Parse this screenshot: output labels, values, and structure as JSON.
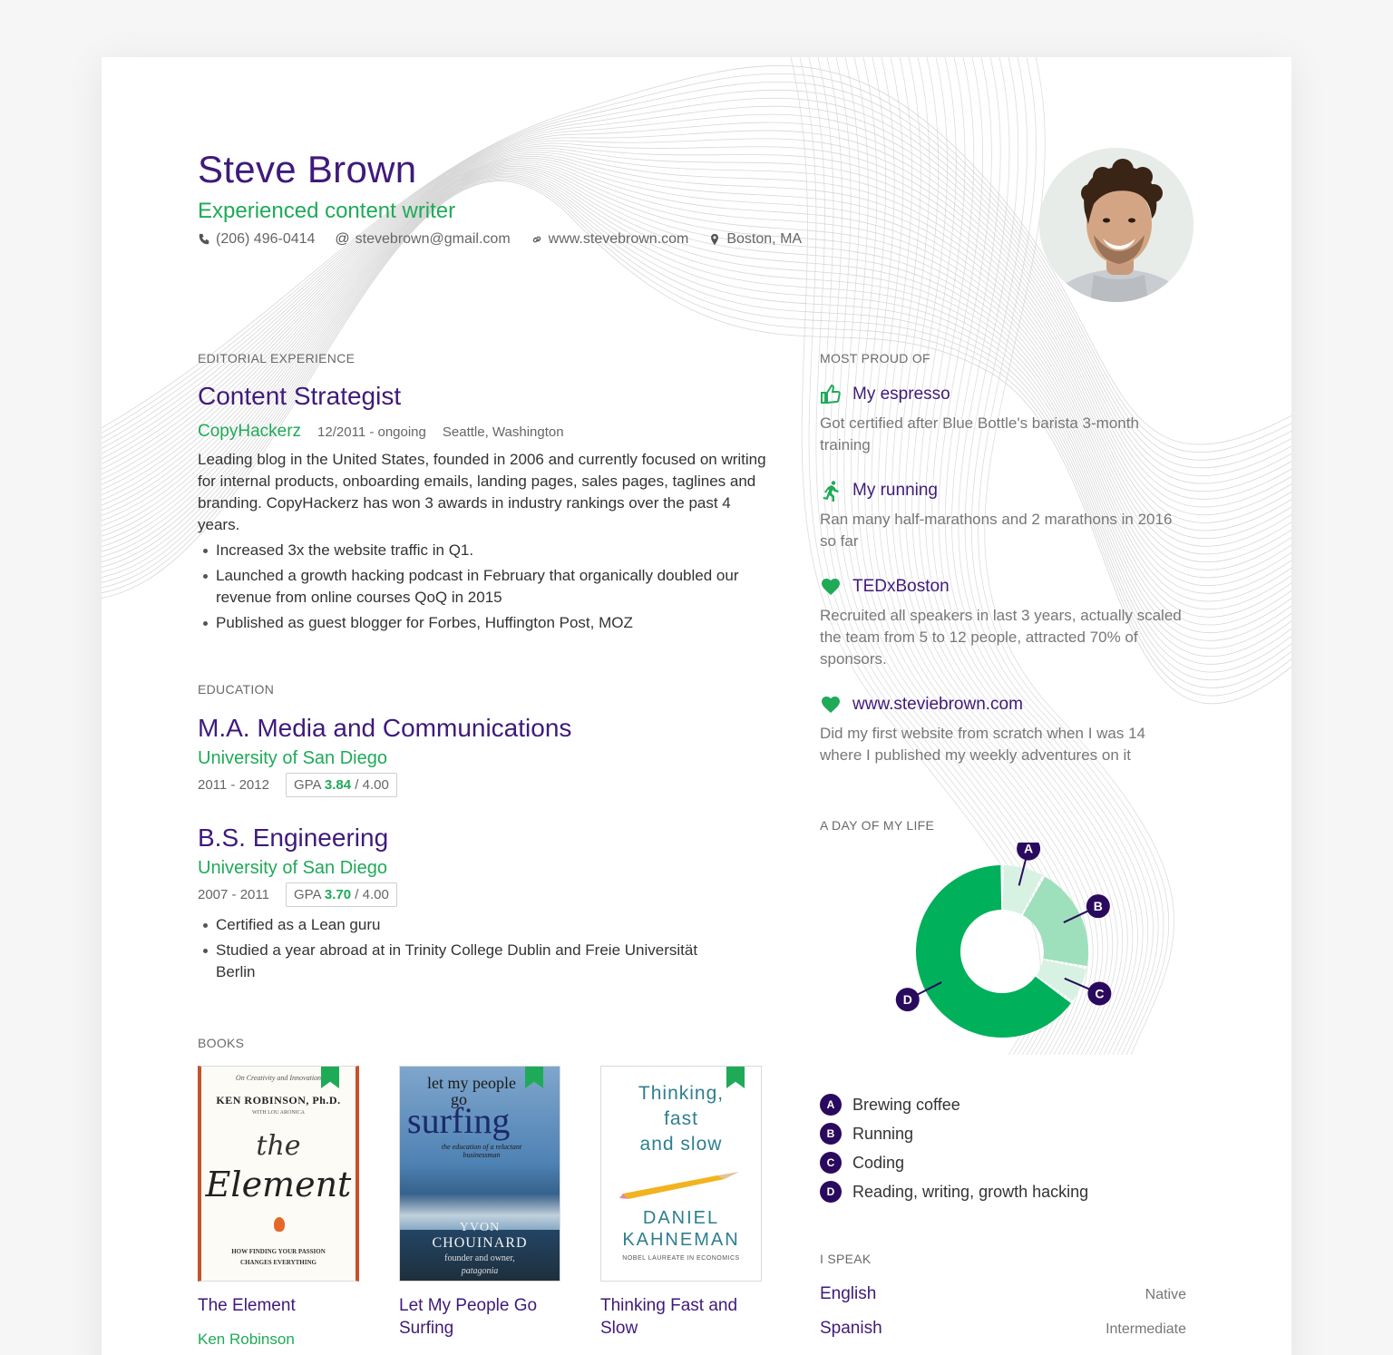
{
  "profile": {
    "name": "Steve Brown",
    "headline": "Experienced content writer",
    "phone": "(206) 496-0414",
    "email": "stevebrown@gmail.com",
    "website": "www.stevebrown.com",
    "location": "Boston, MA"
  },
  "sections": {
    "experience": "EDITORIAL EXPERIENCE",
    "education": "EDUCATION",
    "books": "BOOKS",
    "proud": "MOST PROUD OF",
    "day": "A DAY OF MY LIFE",
    "speak": "I SPEAK"
  },
  "experience": {
    "title": "Content Strategist",
    "company": "CopyHackerz",
    "dates": "12/2011 - ongoing",
    "location": "Seattle, Washington",
    "description": "Leading blog in the United States, founded in 2006 and currently focused on writing for internal products, onboarding emails, landing pages, sales pages, taglines and branding. CopyHackerz has won 3 awards in industry rankings over the past 4 years.",
    "bullets": [
      "Increased 3x the website traffic in Q1.",
      "Launched a growth hacking podcast in February that organically doubled our revenue from online courses QoQ in 2015",
      "Published as guest blogger for Forbes, Huffington Post, MOZ"
    ]
  },
  "education": [
    {
      "degree": "M.A. Media and Communications",
      "school": "University of San Diego",
      "years": "2011 - 2012",
      "gpa_label": "GPA",
      "gpa": "3.84",
      "gpa_max": "/ 4.00",
      "bullets": []
    },
    {
      "degree": "B.S. Engineering",
      "school": "University of San Diego",
      "years": "2007 - 2011",
      "gpa_label": "GPA",
      "gpa": "3.70",
      "gpa_max": "/ 4.00",
      "bullets": [
        "Certified as a Lean guru",
        "Studied a year abroad at in Trinity College Dublin and Freie Universität Berlin"
      ]
    }
  ],
  "books": [
    {
      "title": "The Element",
      "author": "Ken Robinson",
      "cover": {
        "top": "On Creativity and Innovation",
        "author": "KEN ROBINSON, Ph.D.",
        "coauthor": "WITH LOU ARONICA",
        "title1": "the",
        "title2": "Element",
        "sub1": "HOW FINDING YOUR PASSION",
        "sub2": "CHANGES EVERYTHING"
      }
    },
    {
      "title": "Let My People Go Surfing",
      "author": "",
      "cover": {
        "title1": "let my people",
        "title2": "go",
        "title3": "surfing",
        "sub": "the education of a reluctant businessman",
        "author1": "YVON",
        "author2": "CHOUINARD",
        "role": "founder and owner,",
        "brand": "patagonia"
      }
    },
    {
      "title": "Thinking Fast and Slow",
      "author": "",
      "cover": {
        "line1": "Thinking,",
        "line2": "fast",
        "line3": "and slow",
        "author1": "DANIEL",
        "author2": "KAHNEMAN",
        "note": "NOBEL LAUREATE IN ECONOMICS"
      }
    }
  ],
  "proud": [
    {
      "icon": "thumbs-up-icon",
      "title": "My espresso",
      "text": "Got certified after Blue Bottle's barista 3-month training"
    },
    {
      "icon": "running-icon",
      "title": "My running",
      "text": "Ran many half-marathons and 2 marathons in 2016 so far"
    },
    {
      "icon": "heart-icon",
      "title": "TEDxBoston",
      "text": "Recruited all speakers in last 3 years, actually scaled the team from 5 to 12 people, attracted 70% of sponsors."
    },
    {
      "icon": "heart-icon",
      "title": "www.steviebrown.com",
      "text": "Did my first website from scratch when I was 14 where I published my weekly adventures on it"
    }
  ],
  "chart_data": {
    "type": "pie",
    "categories": [
      "A",
      "B",
      "C",
      "D"
    ],
    "legend": [
      "Brewing coffee",
      "Running",
      "Coding",
      "Reading, writing, growth hacking"
    ],
    "values": [
      8,
      20,
      7,
      65
    ],
    "colors": [
      "#d7f2e3",
      "#9ee0bb",
      "#d7f2e3",
      "#00b05a"
    ]
  },
  "languages": [
    {
      "name": "English",
      "level": "Native"
    },
    {
      "name": "Spanish",
      "level": "Intermediate"
    }
  ],
  "colors": {
    "primary": "#3f1a7a",
    "accent": "#1faa58",
    "badge": "#2a0a5e"
  }
}
